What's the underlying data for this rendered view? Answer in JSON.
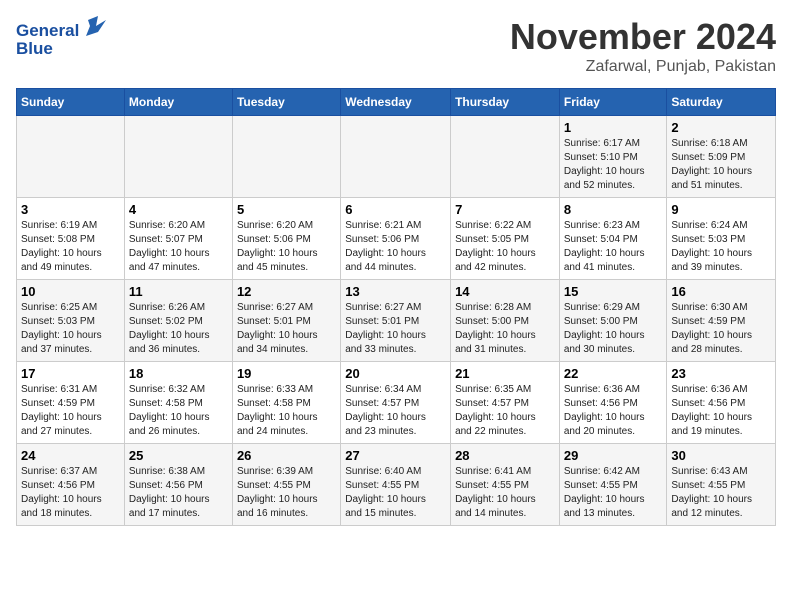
{
  "header": {
    "logo_line1": "General",
    "logo_line2": "Blue",
    "month": "November 2024",
    "location": "Zafarwal, Punjab, Pakistan"
  },
  "weekdays": [
    "Sunday",
    "Monday",
    "Tuesday",
    "Wednesday",
    "Thursday",
    "Friday",
    "Saturday"
  ],
  "weeks": [
    [
      {
        "day": "",
        "info": ""
      },
      {
        "day": "",
        "info": ""
      },
      {
        "day": "",
        "info": ""
      },
      {
        "day": "",
        "info": ""
      },
      {
        "day": "",
        "info": ""
      },
      {
        "day": "1",
        "info": "Sunrise: 6:17 AM\nSunset: 5:10 PM\nDaylight: 10 hours\nand 52 minutes."
      },
      {
        "day": "2",
        "info": "Sunrise: 6:18 AM\nSunset: 5:09 PM\nDaylight: 10 hours\nand 51 minutes."
      }
    ],
    [
      {
        "day": "3",
        "info": "Sunrise: 6:19 AM\nSunset: 5:08 PM\nDaylight: 10 hours\nand 49 minutes."
      },
      {
        "day": "4",
        "info": "Sunrise: 6:20 AM\nSunset: 5:07 PM\nDaylight: 10 hours\nand 47 minutes."
      },
      {
        "day": "5",
        "info": "Sunrise: 6:20 AM\nSunset: 5:06 PM\nDaylight: 10 hours\nand 45 minutes."
      },
      {
        "day": "6",
        "info": "Sunrise: 6:21 AM\nSunset: 5:06 PM\nDaylight: 10 hours\nand 44 minutes."
      },
      {
        "day": "7",
        "info": "Sunrise: 6:22 AM\nSunset: 5:05 PM\nDaylight: 10 hours\nand 42 minutes."
      },
      {
        "day": "8",
        "info": "Sunrise: 6:23 AM\nSunset: 5:04 PM\nDaylight: 10 hours\nand 41 minutes."
      },
      {
        "day": "9",
        "info": "Sunrise: 6:24 AM\nSunset: 5:03 PM\nDaylight: 10 hours\nand 39 minutes."
      }
    ],
    [
      {
        "day": "10",
        "info": "Sunrise: 6:25 AM\nSunset: 5:03 PM\nDaylight: 10 hours\nand 37 minutes."
      },
      {
        "day": "11",
        "info": "Sunrise: 6:26 AM\nSunset: 5:02 PM\nDaylight: 10 hours\nand 36 minutes."
      },
      {
        "day": "12",
        "info": "Sunrise: 6:27 AM\nSunset: 5:01 PM\nDaylight: 10 hours\nand 34 minutes."
      },
      {
        "day": "13",
        "info": "Sunrise: 6:27 AM\nSunset: 5:01 PM\nDaylight: 10 hours\nand 33 minutes."
      },
      {
        "day": "14",
        "info": "Sunrise: 6:28 AM\nSunset: 5:00 PM\nDaylight: 10 hours\nand 31 minutes."
      },
      {
        "day": "15",
        "info": "Sunrise: 6:29 AM\nSunset: 5:00 PM\nDaylight: 10 hours\nand 30 minutes."
      },
      {
        "day": "16",
        "info": "Sunrise: 6:30 AM\nSunset: 4:59 PM\nDaylight: 10 hours\nand 28 minutes."
      }
    ],
    [
      {
        "day": "17",
        "info": "Sunrise: 6:31 AM\nSunset: 4:59 PM\nDaylight: 10 hours\nand 27 minutes."
      },
      {
        "day": "18",
        "info": "Sunrise: 6:32 AM\nSunset: 4:58 PM\nDaylight: 10 hours\nand 26 minutes."
      },
      {
        "day": "19",
        "info": "Sunrise: 6:33 AM\nSunset: 4:58 PM\nDaylight: 10 hours\nand 24 minutes."
      },
      {
        "day": "20",
        "info": "Sunrise: 6:34 AM\nSunset: 4:57 PM\nDaylight: 10 hours\nand 23 minutes."
      },
      {
        "day": "21",
        "info": "Sunrise: 6:35 AM\nSunset: 4:57 PM\nDaylight: 10 hours\nand 22 minutes."
      },
      {
        "day": "22",
        "info": "Sunrise: 6:36 AM\nSunset: 4:56 PM\nDaylight: 10 hours\nand 20 minutes."
      },
      {
        "day": "23",
        "info": "Sunrise: 6:36 AM\nSunset: 4:56 PM\nDaylight: 10 hours\nand 19 minutes."
      }
    ],
    [
      {
        "day": "24",
        "info": "Sunrise: 6:37 AM\nSunset: 4:56 PM\nDaylight: 10 hours\nand 18 minutes."
      },
      {
        "day": "25",
        "info": "Sunrise: 6:38 AM\nSunset: 4:56 PM\nDaylight: 10 hours\nand 17 minutes."
      },
      {
        "day": "26",
        "info": "Sunrise: 6:39 AM\nSunset: 4:55 PM\nDaylight: 10 hours\nand 16 minutes."
      },
      {
        "day": "27",
        "info": "Sunrise: 6:40 AM\nSunset: 4:55 PM\nDaylight: 10 hours\nand 15 minutes."
      },
      {
        "day": "28",
        "info": "Sunrise: 6:41 AM\nSunset: 4:55 PM\nDaylight: 10 hours\nand 14 minutes."
      },
      {
        "day": "29",
        "info": "Sunrise: 6:42 AM\nSunset: 4:55 PM\nDaylight: 10 hours\nand 13 minutes."
      },
      {
        "day": "30",
        "info": "Sunrise: 6:43 AM\nSunset: 4:55 PM\nDaylight: 10 hours\nand 12 minutes."
      }
    ]
  ]
}
